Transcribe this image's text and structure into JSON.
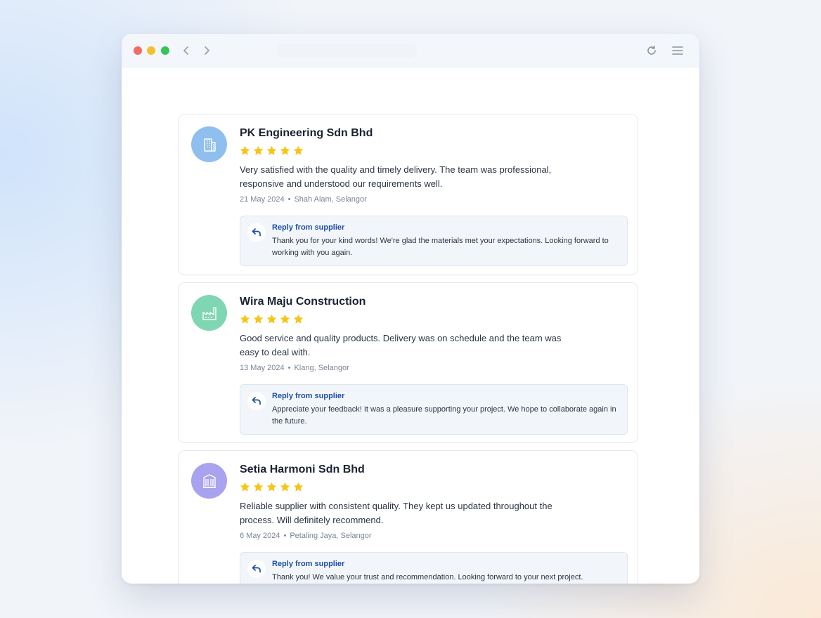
{
  "reviews": [
    {
      "name": "PK Engineering Sdn Bhd",
      "rating": 5,
      "avatar_icon": "building-icon",
      "avatar_color": "#8fbfee",
      "text": "Very satisfied with the quality and timely delivery. The team was professional, responsive and understood our requirements well.",
      "date": "21 May 2024",
      "location": "Shah Alam, Selangor",
      "reply_title": "Reply from supplier",
      "reply_text": "Thank you for your kind words! We're glad the materials met your expectations. Looking forward to working with you again."
    },
    {
      "name": "Wira Maju Construction",
      "rating": 5,
      "avatar_icon": "factory-icon",
      "avatar_color": "#7fd6b3",
      "text": "Good service and quality products. Delivery was on schedule and the team was easy to deal with.",
      "date": "13 May 2024",
      "location": "Klang, Selangor",
      "reply_title": "Reply from supplier",
      "reply_text": "Appreciate your feedback! It was a pleasure supporting your project. We hope to collaborate again in the future."
    },
    {
      "name": "Setia Harmoni Sdn Bhd",
      "rating": 5,
      "avatar_icon": "office-building-icon",
      "avatar_color": "#a9a2ee",
      "text": "Reliable supplier with consistent quality. They kept us updated throughout the process. Will definitely recommend.",
      "date": "6 May 2024",
      "location": "Petaling Jaya, Selangor",
      "reply_title": "Reply from supplier",
      "reply_text": "Thank you! We value your trust and recommendation. Looking forward to your next project."
    }
  ],
  "colors": {
    "star": "#f5c518",
    "accent": "#1e4fa3"
  }
}
